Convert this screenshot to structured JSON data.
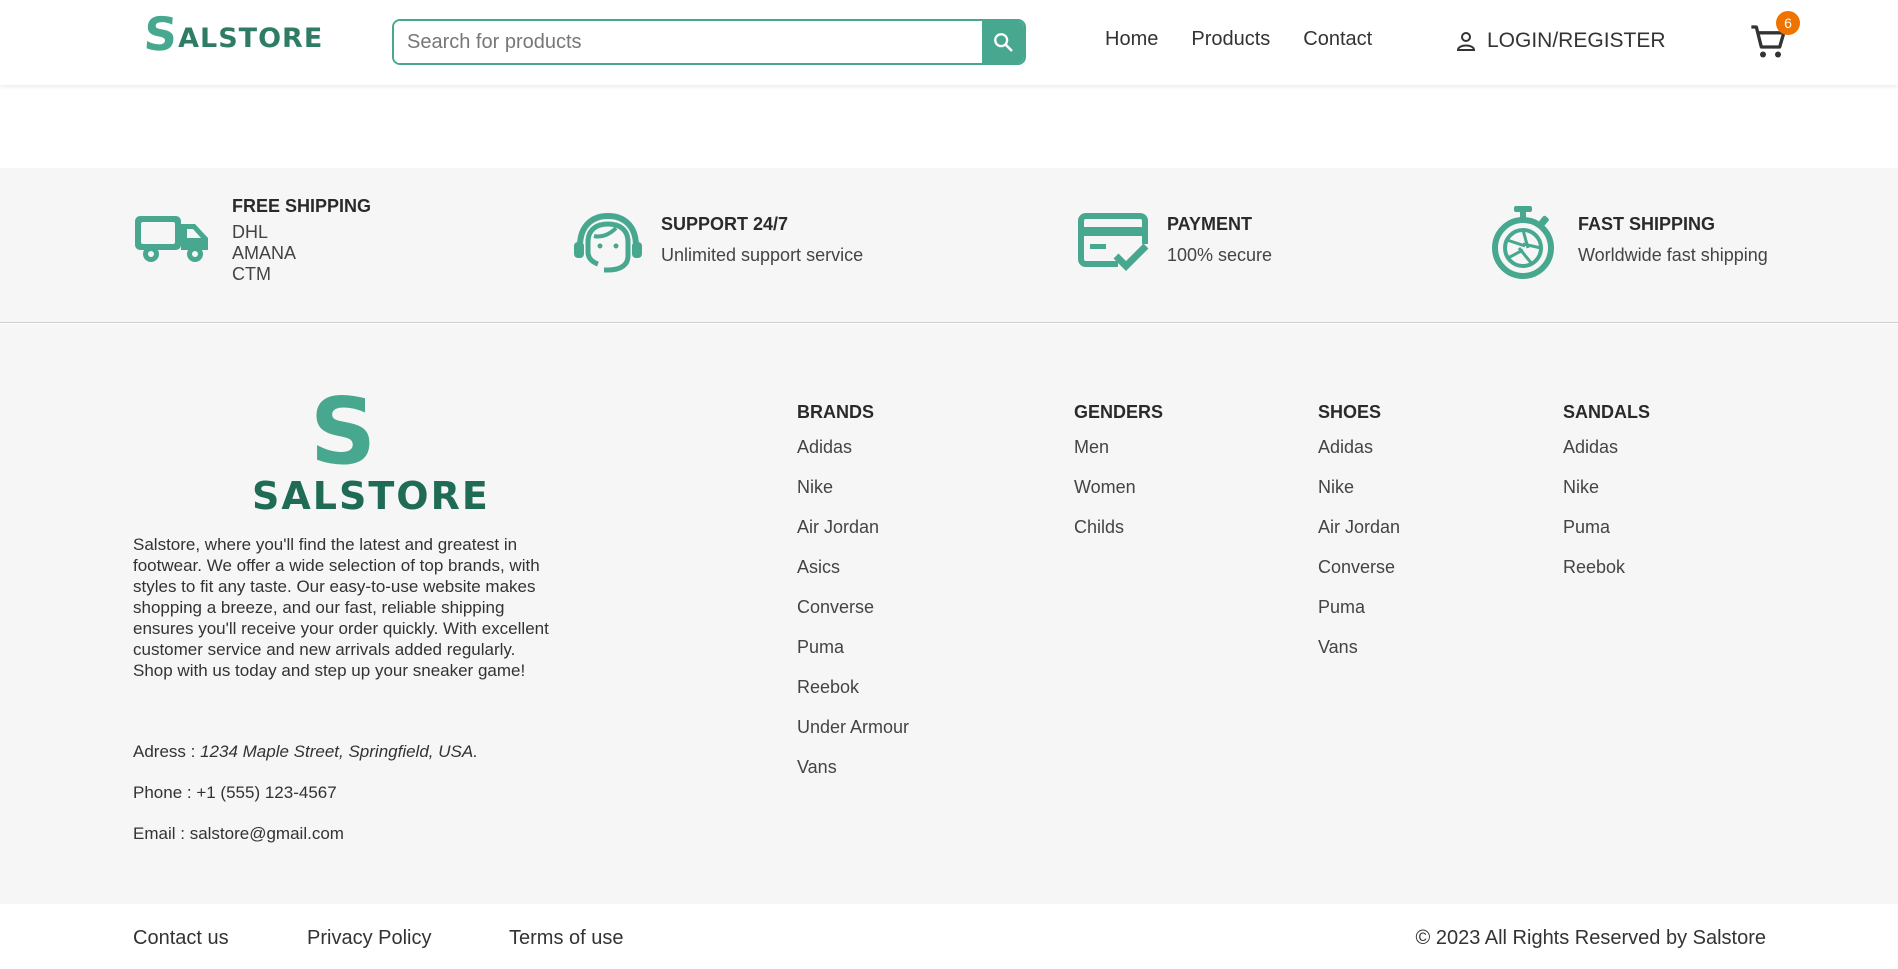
{
  "header": {
    "logo_s": "S",
    "logo_rest": "ALSTORE",
    "search_placeholder": "Search for products",
    "nav": [
      "Home",
      "Products",
      "Contact"
    ],
    "login_label": "LOGIN/REGISTER",
    "cart_count": "6"
  },
  "features": [
    {
      "title": "FREE SHIPPING",
      "lines": [
        "DHL",
        "AMANA",
        "CTM"
      ],
      "icon": "truck-icon"
    },
    {
      "title": "SUPPORT 24/7",
      "lines": [
        "Unlimited support service"
      ],
      "icon": "headset-icon"
    },
    {
      "title": "PAYMENT",
      "lines": [
        "100% secure"
      ],
      "icon": "credit-card-check-icon"
    },
    {
      "title": "FAST SHIPPING",
      "lines": [
        "Worldwide fast shipping"
      ],
      "icon": "stopwatch-icon"
    }
  ],
  "footer": {
    "logo_letter": "S",
    "logo_word": "SALSTORE",
    "about": "Salstore, where you'll find the latest and greatest in footwear. We offer a wide selection of top brands, with styles to fit any taste. Our easy-to-use website makes shopping a breeze, and our fast, reliable shipping ensures you'll receive your order quickly. With excellent customer service and new arrivals added regularly. Shop with us today and step up your sneaker game!",
    "address_label": "Adress : ",
    "address": "1234 Maple Street, Springfield, USA.",
    "phone_label": "Phone : ",
    "phone": "+1 (555) 123-4567",
    "email_label": "Email : ",
    "email": "salstore@gmail.com",
    "columns": [
      {
        "title": "BRANDS",
        "items": [
          "Adidas",
          "Nike",
          "Air Jordan",
          "Asics",
          "Converse",
          "Puma",
          "Reebok",
          "Under Armour",
          "Vans"
        ]
      },
      {
        "title": "GENDERS",
        "items": [
          "Men",
          "Women",
          "Childs"
        ]
      },
      {
        "title": "SHOES",
        "items": [
          "Adidas",
          "Nike",
          "Air Jordan",
          "Converse",
          "Puma",
          "Vans"
        ]
      },
      {
        "title": "SANDALS",
        "items": [
          "Adidas",
          "Nike",
          "Puma",
          "Reebok"
        ]
      }
    ]
  },
  "bottom": {
    "links": [
      "Contact us",
      "Privacy Policy",
      "Terms of use"
    ],
    "copyright": "© 2023 All Rights Reserved by Salstore"
  },
  "colors": {
    "accent": "#47a88f",
    "dark_accent": "#1f6b55",
    "badge": "#f07300"
  }
}
